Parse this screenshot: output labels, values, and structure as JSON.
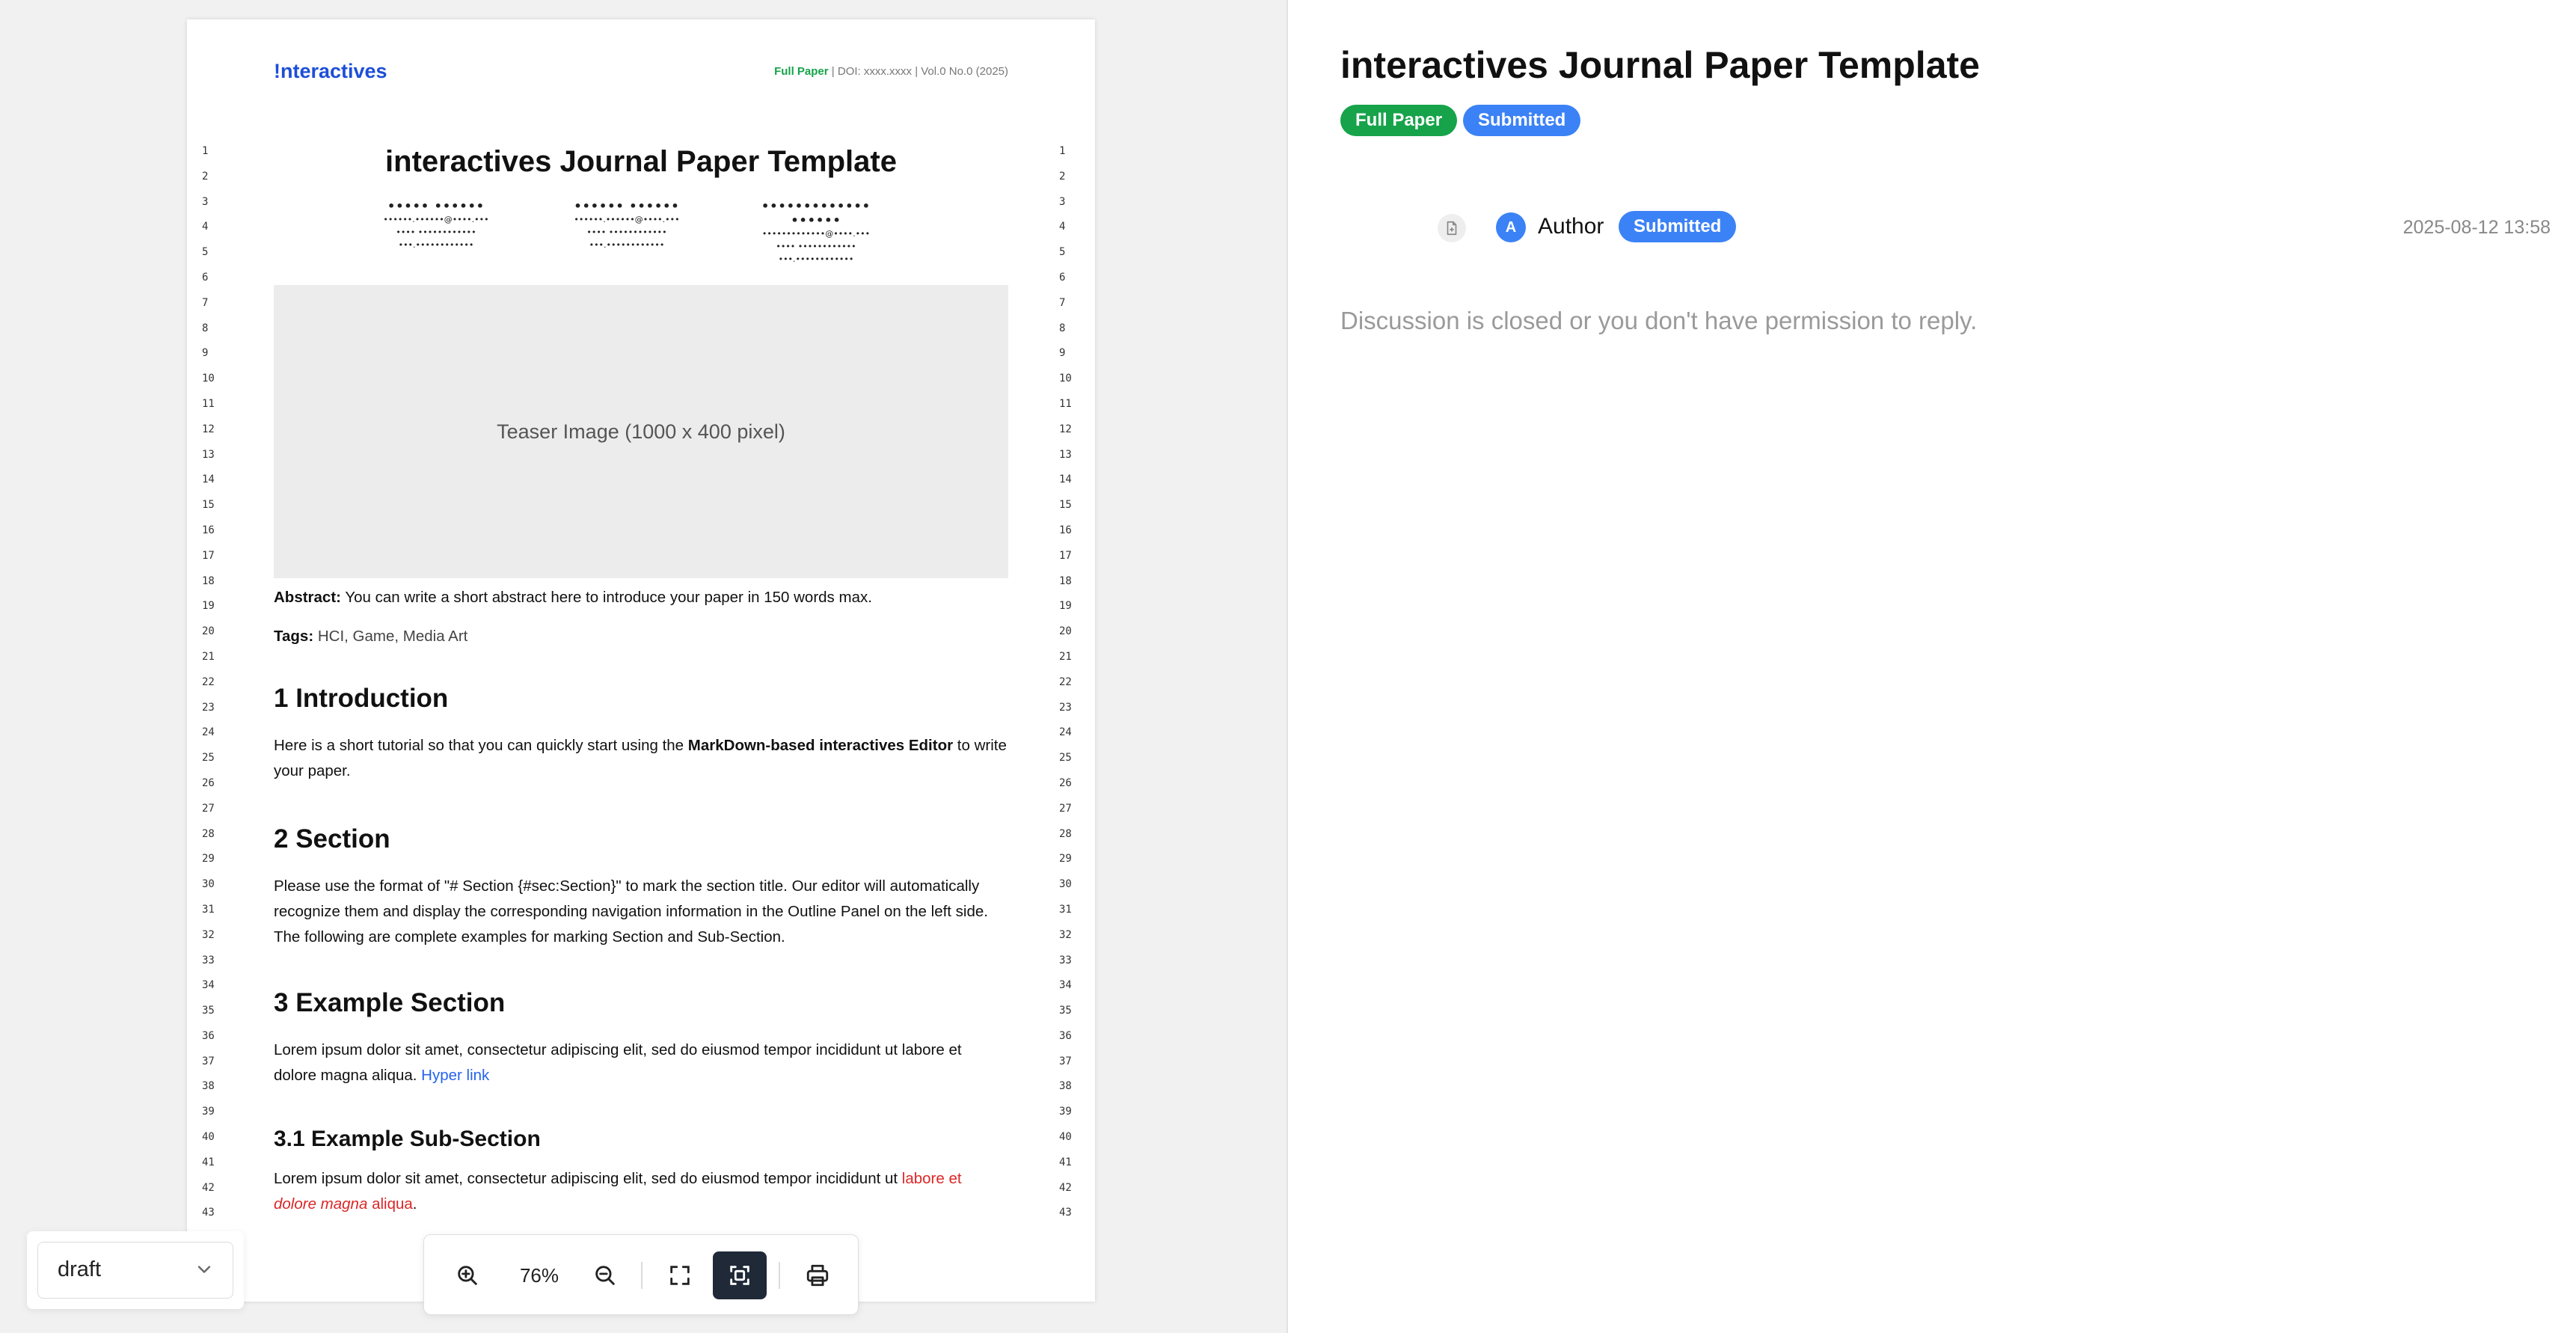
{
  "paper": {
    "brand": "!nteractives",
    "pub_type": "Full Paper",
    "pub_meta": " | DOI: xxxx.xxxx | Vol.0 No.0 (2025)",
    "title": "interactives Journal Paper Template",
    "authors": [
      {
        "name": "••••• ••••••",
        "email": "••••••.••••••@••••.•••",
        "aff1": "•••• ••••••••••••",
        "aff2": "•••.••••••••••••"
      },
      {
        "name": "•••••• ••••••",
        "email": "••••••.••••••@••••.•••",
        "aff1": "•••• ••••••••••••",
        "aff2": "•••.••••••••••••"
      },
      {
        "name": "••••••••••••• ••••••",
        "email": "•••••••••••••@••••.•••",
        "aff1": "•••• ••••••••••••",
        "aff2": "•••.••••••••••••"
      }
    ],
    "teaser": "Teaser Image (1000 x 400 pixel)",
    "abstract_label": "Abstract:",
    "abstract_text": " You can write a short abstract here to introduce your paper in 150 words max.",
    "tags_label": "Tags:",
    "tags_text": " HCI, Game, Media Art",
    "intro_heading": "1 Introduction",
    "intro_pre": "Here is a short tutorial so that you can quickly start using the ",
    "intro_bold": "MarkDown-based interactives Editor",
    "intro_post": " to write your paper.",
    "section_heading": "2 Section",
    "section_text": "Please use the format of \"# Section {#sec:Section}\" to mark the section title. Our editor will automatically recognize them and display the corresponding navigation information in the Outline Panel on the left side. The following are complete examples for marking Section and Sub-Section.",
    "example_heading": "3 Example Section",
    "example_text": "Lorem ipsum dolor sit amet, consectetur adipiscing elit, sed do eiusmod tempor incididunt ut labore et dolore magna aliqua. ",
    "example_link": "Hyper link",
    "sub_heading": "3.1 Example Sub-Section",
    "sub_pre": "Lorem ipsum dolor sit amet, consectetur adipiscing elit, sed do eiusmod tempor incididunt ut ",
    "sub_red1": "labore et ",
    "sub_red_italic": "dolore magna",
    "sub_red2": " aliqua",
    "sub_post": ".",
    "line_numbers": [
      "1",
      "2",
      "3",
      "4",
      "5",
      "6",
      "7",
      "8",
      "9",
      "10",
      "11",
      "12",
      "13",
      "14",
      "15",
      "16",
      "17",
      "18",
      "19",
      "20",
      "21",
      "22",
      "23",
      "24",
      "25",
      "26",
      "27",
      "28",
      "29",
      "30",
      "31",
      "32",
      "33",
      "34",
      "35",
      "36",
      "37",
      "38",
      "39",
      "40",
      "41",
      "42",
      "43"
    ]
  },
  "toolbar": {
    "zoom": "76%",
    "icons": [
      "zoom-in-icon",
      "zoom-out-icon",
      "fullscreen-icon",
      "fit-page-icon",
      "print-icon"
    ]
  },
  "version": {
    "selected": "draft"
  },
  "right": {
    "title": "interactives Journal Paper Template",
    "badge_type": "Full Paper",
    "badge_status": "Submitted",
    "avatar_letter": "A",
    "author": "Author",
    "author_status": "Submitted",
    "timestamp": "2025-08-12 13:58",
    "closed_message": "Discussion is closed or you don't have permission to reply."
  },
  "colors": {
    "brand": "#1d4ed8",
    "full_paper_badge": "#16a34a",
    "submitted_badge": "#3b82f6",
    "link": "#2563eb",
    "highlight_red": "#dc2626"
  }
}
